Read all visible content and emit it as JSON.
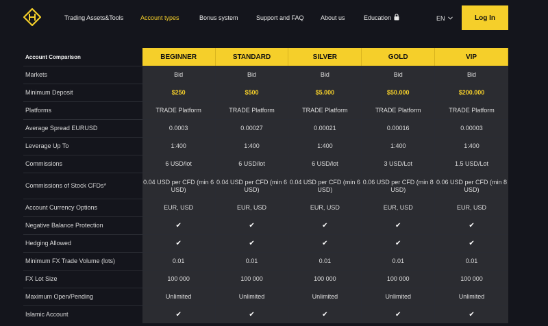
{
  "nav": {
    "links": [
      {
        "label": "Trading Assets&Tools",
        "active": false
      },
      {
        "label": "Account types",
        "active": true
      },
      {
        "label": "Bonus system",
        "active": false
      },
      {
        "label": "Support and FAQ",
        "active": false
      },
      {
        "label": "About us",
        "active": false
      },
      {
        "label": "Education",
        "active": false,
        "icon": "lock-icon"
      }
    ],
    "language": "EN",
    "login_label": "Log In"
  },
  "colors": {
    "background": "#14151c",
    "accent": "#f5cf2a",
    "cell": "#2b2c31"
  },
  "table": {
    "title": "Account Comparison",
    "plans": [
      "BEGINNER",
      "STANDARD",
      "SILVER",
      "GOLD",
      "VIP"
    ],
    "rows": [
      {
        "label": "Markets",
        "values": [
          "Bid",
          "Bid",
          "Bid",
          "Bid",
          "Bid"
        ]
      },
      {
        "label": "Minimum Deposit",
        "values": [
          "$250",
          "$500",
          "$5.000",
          "$50.000",
          "$200.000"
        ]
      },
      {
        "label": "Platforms",
        "values": [
          "TRADE Platform",
          "TRADE Platform",
          "TRADE Platform",
          "TRADE Platform",
          "TRADE Platform"
        ]
      },
      {
        "label": "Average Spread EURUSD",
        "values": [
          "0.0003",
          "0.00027",
          "0.00021",
          "0.00016",
          "0.00003"
        ]
      },
      {
        "label": "Leverage Up To",
        "values": [
          "1:400",
          "1:400",
          "1:400",
          "1:400",
          "1:400"
        ]
      },
      {
        "label": "Commissions",
        "values": [
          "6 USD/lot",
          "6 USD/lot",
          "6 USD/lot",
          "3 USD/Lot",
          "1.5 USD/Lot"
        ]
      },
      {
        "label": "Commissions of Stock CFDs*",
        "values": [
          "0.04 USD per CFD (min 6 USD)",
          "0.04 USD per CFD (min 6 USD)",
          "0.04 USD per CFD (min 6 USD)",
          "0.06 USD per CFD (min 8 USD)",
          "0.06 USD per CFD (min 8 USD)"
        ]
      },
      {
        "label": "Account Currency Options",
        "values": [
          "EUR, USD",
          "EUR, USD",
          "EUR, USD",
          "EUR, USD",
          "EUR, USD"
        ]
      },
      {
        "label": "Negative Balance Protection",
        "values": [
          "✔",
          "✔",
          "✔",
          "✔",
          "✔"
        ]
      },
      {
        "label": "Hedging Allowed",
        "values": [
          "✔",
          "✔",
          "✔",
          "✔",
          "✔"
        ]
      },
      {
        "label": "Minimum FX Trade Volume (lots)",
        "values": [
          "0.01",
          "0.01",
          "0.01",
          "0.01",
          "0.01"
        ]
      },
      {
        "label": "FX Lot Size",
        "values": [
          "100 000",
          "100 000",
          "100 000",
          "100 000",
          "100 000"
        ]
      },
      {
        "label": "Maximum Open/Pending",
        "values": [
          "Unlimited",
          "Unlimited",
          "Unlimited",
          "Unlimited",
          "Unlimited"
        ]
      },
      {
        "label": "Islamic Account",
        "values": [
          "✔",
          "✔",
          "✔",
          "✔",
          "✔"
        ]
      }
    ]
  }
}
